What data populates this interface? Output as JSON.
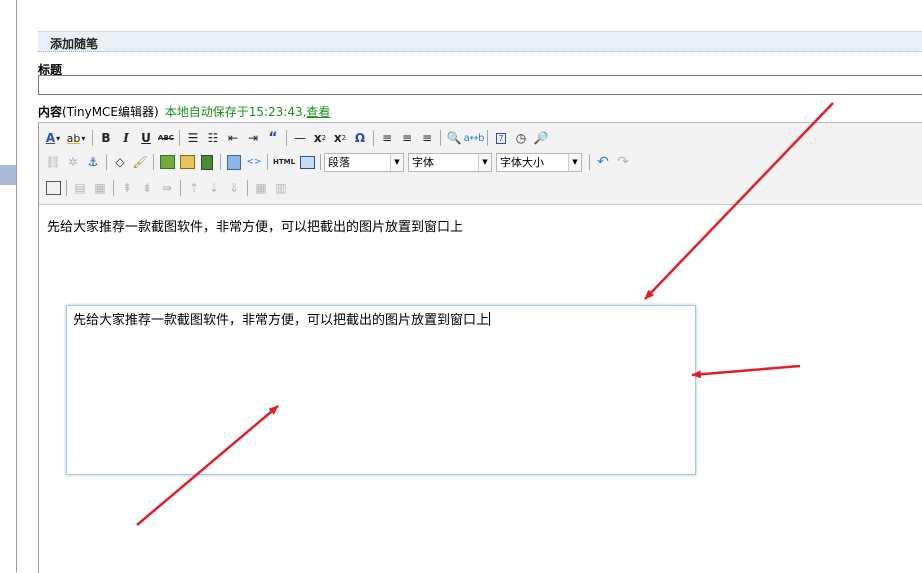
{
  "section_header": "添加随笔",
  "title_label": "标题",
  "title_value": "",
  "content_label": {
    "bold": "内容",
    "editor_name": "(TinyMCE编辑器)",
    "autosave": "本地自动保存于15:23:43,",
    "view_link": "查看"
  },
  "toolbar": {
    "row1": [
      "A",
      "ab",
      "B",
      "I",
      "U",
      "ABC",
      "list-unordered",
      "list-ordered",
      "outdent",
      "indent",
      "blockquote",
      "hr",
      "subscript",
      "superscript",
      "Ω",
      "align-left",
      "align-center",
      "align-right",
      "find",
      "replace",
      "insert-date",
      "insert-time",
      "preview"
    ],
    "format_select": "段落",
    "font_select": "字体",
    "size_select": "字体大小",
    "html_button": "HTML"
  },
  "editor_text": "先给大家推荐一款截图软件，非常方便，可以把截出的图片放置到窗口上",
  "pasted_text": "先给大家推荐一款截图软件，非常方便，可以把截出的图片放置到窗口上",
  "colors": {
    "accent_arrow": "#e31f26",
    "link_green": "#1a8f1a",
    "header_bg": "#eaf0f7"
  }
}
